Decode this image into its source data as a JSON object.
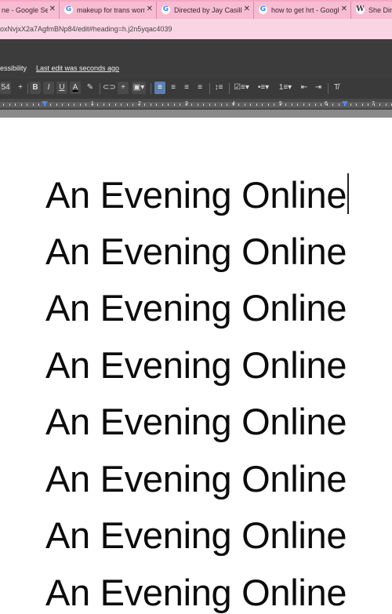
{
  "browser": {
    "tabs": [
      {
        "label": "ne - Google Sear",
        "favicon": "google-icon"
      },
      {
        "label": "makeup for trans women",
        "favicon": "google-icon"
      },
      {
        "label": "Directed by Jay Casillas - G",
        "favicon": "google-icon"
      },
      {
        "label": "how to get hrt - Google Se",
        "favicon": "google-icon"
      },
      {
        "label": "She Dir",
        "favicon": "wikipedia-icon"
      }
    ],
    "url": "oxNvjxX2a7AgfmBNp84/edit#heading=h.j2n5yqac4039"
  },
  "docs": {
    "menu_accessibility": "essibility",
    "last_edit": "Last edit was seconds ago",
    "toolbar": {
      "font_size": "54",
      "plus": "+",
      "bold": "B",
      "italic": "I",
      "underline": "U",
      "text_color": "A"
    },
    "ruler_numbers": [
      "1",
      "2",
      "3",
      "4",
      "5",
      "6",
      "7"
    ]
  },
  "document": {
    "lines": [
      "An Evening Online",
      "An Evening Online",
      "An Evening Online",
      "An Evening Online",
      "An Evening Online",
      "An Evening Online",
      "An Evening Online",
      "An Evening Online"
    ]
  },
  "colors": {
    "tabbar": "#f4a7c3",
    "addressbar": "#f9d4e2",
    "toolbar": "#3a3a3a",
    "accent": "#4a8af4"
  }
}
